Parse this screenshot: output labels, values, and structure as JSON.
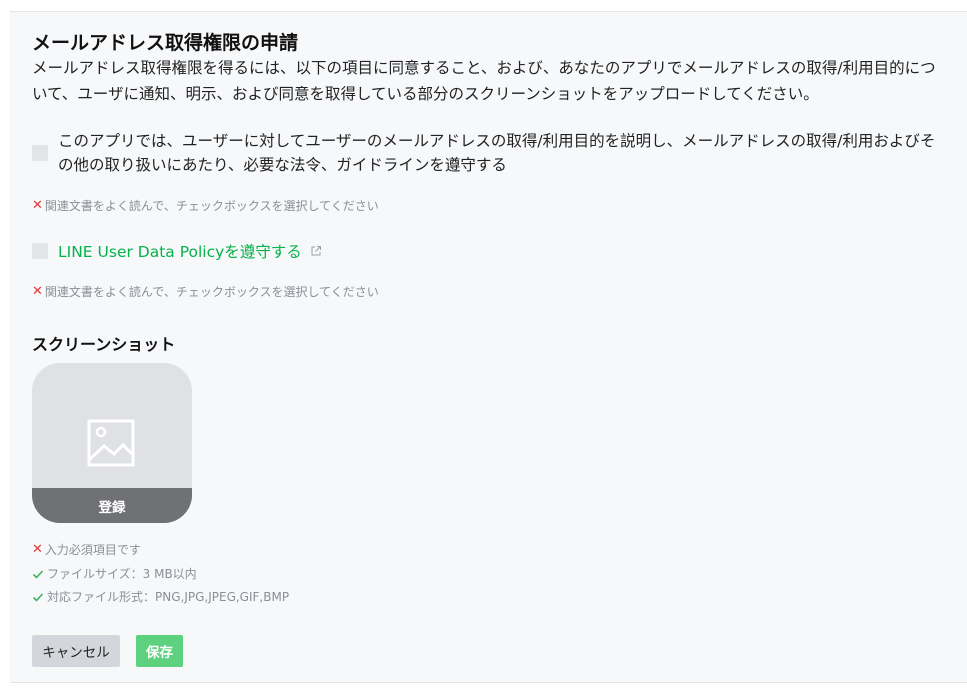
{
  "form": {
    "title": "メールアドレス取得権限の申請",
    "description": "メールアドレス取得権限を得るには、以下の項目に同意すること、および、あなたのアプリでメールアドレスの取得/利用目的について、ユーザに通知、明示、および同意を取得している部分のスクリーンショットをアップロードしてください。",
    "agreement_text": "このアプリでは、ユーザーに対してユーザーのメールアドレスの取得/利用目的を説明し、メールアドレスの取得/利用およびその他の取り扱いにあたり、必要な法令、ガイドラインを遵守する",
    "agreement_error": "関連文書をよく読んで、チェックボックスを選択してください",
    "policy_link_label": "LINE User Data Policyを遵守する",
    "policy_error": "関連文書をよく読んで、チェックボックスを選択してください"
  },
  "screenshot": {
    "section_title": "スクリーンショット",
    "upload_label": "登録",
    "requirements": [
      {
        "status": "error",
        "text": "入力必須項目です"
      },
      {
        "status": "ok",
        "text": "ファイルサイズ：3 MB以内"
      },
      {
        "status": "ok",
        "text": "対応ファイル形式：PNG,JPG,JPEG,GIF,BMP"
      }
    ]
  },
  "actions": {
    "cancel_label": "キャンセル",
    "save_label": "保存"
  },
  "colors": {
    "link": "#06b24a",
    "error_mark": "#e0383b",
    "ok_mark": "#3cb55e",
    "save_button": "#5ed17f"
  },
  "icons": {
    "external": "external-link-icon",
    "image": "image-placeholder-icon",
    "error": "x-icon",
    "ok": "check-icon"
  }
}
